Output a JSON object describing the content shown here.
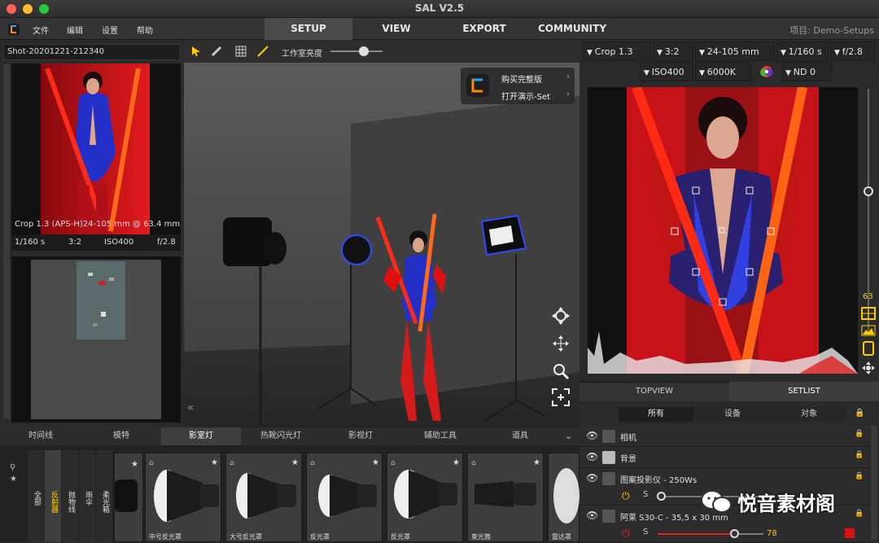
{
  "window": {
    "title": "SAL V2.5"
  },
  "menu": {
    "items": [
      "文件",
      "编辑",
      "设置",
      "帮助"
    ]
  },
  "nav": {
    "tabs": [
      "SETUP",
      "VIEW",
      "EXPORT",
      "COMMUNITY"
    ],
    "active": "SETUP",
    "project": "项目: Demo-Setups"
  },
  "left": {
    "shot_name": "Shot-20201221-212340",
    "info_line1": "Crop 1.3 (APS-H)",
    "info_line1b": "24-105 mm @ 63.4 mm",
    "info_shutter": "1/160 s",
    "info_ratio": "3:2",
    "info_iso": "ISO400",
    "info_aperture": "f/2.8"
  },
  "viewport": {
    "toolbar_label": "工作室亮度",
    "popup_buy": "购买完整版",
    "popup_open": "打开演示-Set"
  },
  "camera": {
    "crop": "Crop 1.3",
    "ratio": "3:2",
    "lens": "24-105 mm",
    "shutter": "1/160 s",
    "aperture": "f/2.8",
    "iso": "ISO400",
    "wb": "6000K",
    "nd": "ND 0"
  },
  "right_side": {
    "zoom_value": "63"
  },
  "panel_tabs": {
    "topview": "TOPVIEW",
    "setlist": "SETLIST"
  },
  "filter_tabs": [
    "所有",
    "设备",
    "对象"
  ],
  "setlist": [
    {
      "label": "相机"
    },
    {
      "label": "背景"
    },
    {
      "label": "图案投影仪 - 250Ws"
    },
    {
      "label": "S"
    },
    {
      "label": "阿莱 S30-C - 35,5 x 30 mm"
    },
    {
      "label": "S",
      "value": "78"
    }
  ],
  "bottom": {
    "tabs": [
      "时间线",
      "模特",
      "影室灯",
      "热靴闪光灯",
      "影视灯",
      "辅助工具",
      "道具"
    ],
    "active_tab": "影室灯",
    "categories": [
      "全部",
      "反射器",
      "抛物线",
      "雨伞",
      "柔光箱"
    ],
    "cards": [
      "中号反光罩",
      "大号反光罩",
      "反光罩",
      "反光罩",
      "束光筒",
      "雷达罩"
    ]
  },
  "watermark": "悦音素材阁",
  "colors": {
    "accent": "#ffcc00",
    "red": "#e01010",
    "blue": "#2f4bff"
  }
}
